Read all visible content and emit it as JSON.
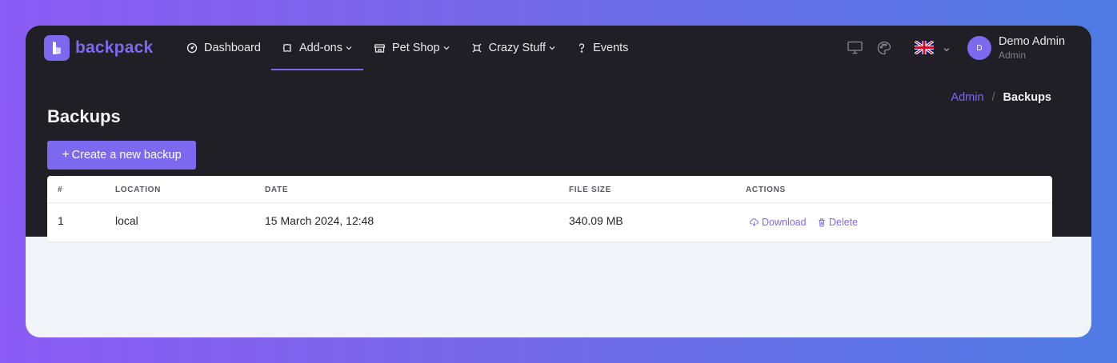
{
  "brand": {
    "name": "backpack",
    "color": "#7c69ef"
  },
  "nav": {
    "items": [
      {
        "label": "Dashboard",
        "icon": "dashboard-gauge-icon"
      },
      {
        "label": "Add-ons",
        "icon": "puzzle-icon",
        "active": true,
        "dropdown": true
      },
      {
        "label": "Pet Shop",
        "icon": "shop-icon",
        "dropdown": true
      },
      {
        "label": "Crazy Stuff",
        "icon": "crazy-stuff-icon",
        "dropdown": true
      },
      {
        "label": "Events",
        "icon": "question-icon"
      }
    ]
  },
  "header_tools": {
    "icons": [
      "monitor-icon",
      "palette-icon",
      "uk-flag-icon",
      "chevron-down-icon"
    ]
  },
  "user": {
    "initial": "D",
    "name": "Demo Admin",
    "role": "Admin"
  },
  "breadcrumb": {
    "root": "Admin",
    "separator": "/",
    "current": "Backups"
  },
  "page": {
    "title": "Backups",
    "create_button": "Create a new backup"
  },
  "table": {
    "headers": [
      "#",
      "LOCATION",
      "DATE",
      "FILE SIZE",
      "ACTIONS"
    ],
    "rows": [
      {
        "index": "1",
        "location": "local",
        "date": "15 March 2024, 12:48",
        "file_size": "340.09 MB",
        "download_label": "Download",
        "delete_label": "Delete"
      }
    ]
  },
  "colors": {
    "accent": "#7c69ef",
    "header_bg": "#201f25",
    "page_bg": "#f1f4f8"
  }
}
